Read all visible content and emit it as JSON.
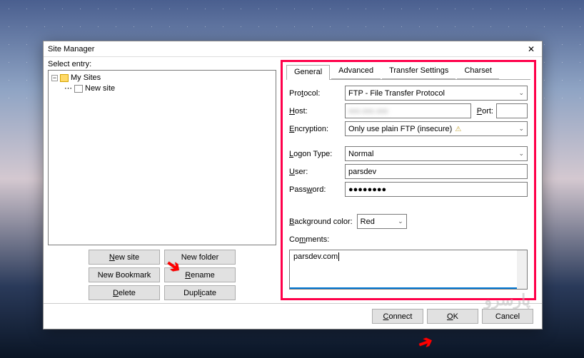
{
  "window": {
    "title": "Site Manager"
  },
  "left": {
    "label": "Select entry:",
    "tree": {
      "root": "My Sites",
      "child": "New site"
    },
    "buttons": {
      "new_site": "New site",
      "new_folder": "New folder",
      "new_bookmark": "New Bookmark",
      "rename": "Rename",
      "delete": "Delete",
      "duplicate": "Duplicate"
    }
  },
  "tabs": {
    "general": "General",
    "advanced": "Advanced",
    "transfer": "Transfer Settings",
    "charset": "Charset"
  },
  "form": {
    "protocol_label": "Protocol:",
    "protocol_value": "FTP - File Transfer Protocol",
    "host_label": "Host:",
    "host_value": "xxx.xxx.xxx",
    "port_label": "Port:",
    "port_value": "",
    "encryption_label": "Encryption:",
    "encryption_value": "Only use plain FTP (insecure)",
    "logon_label": "Logon Type:",
    "logon_value": "Normal",
    "user_label": "User:",
    "user_value": "parsdev",
    "password_label": "Password:",
    "password_value": "●●●●●●●●",
    "bg_label": "Background color:",
    "bg_value": "Red",
    "comments_label": "Comments:",
    "comments_value": "parsdev.com"
  },
  "footer": {
    "connect": "Connect",
    "ok": "OK",
    "cancel": "Cancel"
  },
  "watermark": "پارسرو"
}
